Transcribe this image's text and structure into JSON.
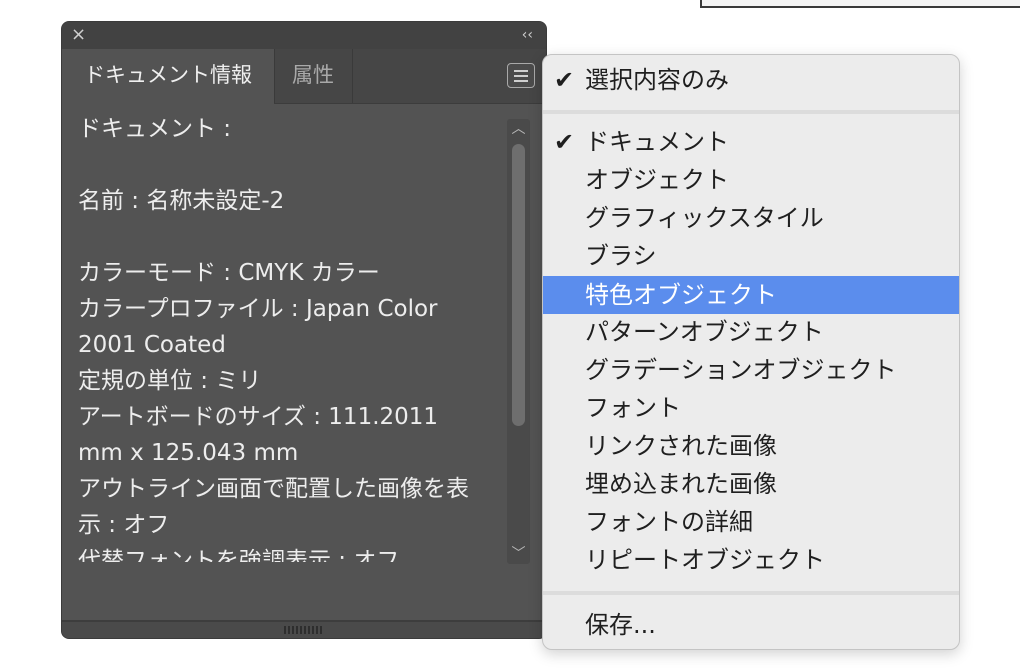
{
  "panel": {
    "close_icon": "×",
    "collapse_icon": "‹‹",
    "tabs": [
      {
        "label": "ドキュメント情報",
        "active": true
      },
      {
        "label": "属性",
        "active": false
      }
    ],
    "menu_icon": "hamburger-menu-icon",
    "content_lines": [
      "ドキュメント :",
      "",
      "名前 : 名称未設定-2",
      "",
      "カラーモード : CMYK カラー",
      "カラープロファイル : Japan Color",
      "2001 Coated",
      "定規の単位 : ミリ",
      "アートボードのサイズ : 111.2011",
      "mm x 125.043 mm",
      "アウトライン画面で配置した画像を表",
      "示 : オフ",
      "代替フォントを強調表示 : オフ"
    ]
  },
  "menu": {
    "items": [
      {
        "label": "選択内容のみ",
        "checked": true
      },
      {
        "label": "ドキュメント",
        "checked": true
      },
      {
        "label": "オブジェクト",
        "checked": false
      },
      {
        "label": "グラフィックスタイル",
        "checked": false
      },
      {
        "label": "ブラシ",
        "checked": false
      },
      {
        "label": "特色オブジェクト",
        "checked": false,
        "highlighted": true
      },
      {
        "label": "パターンオブジェクト",
        "checked": false
      },
      {
        "label": "グラデーションオブジェクト",
        "checked": false
      },
      {
        "label": "フォント",
        "checked": false
      },
      {
        "label": "リンクされた画像",
        "checked": false
      },
      {
        "label": "埋め込まれた画像",
        "checked": false
      },
      {
        "label": "フォントの詳細",
        "checked": false
      },
      {
        "label": "リピートオブジェクト",
        "checked": false
      },
      {
        "label": "保存...",
        "checked": false
      }
    ],
    "check_glyph": "✔",
    "highlight_color": "#5b8ded"
  }
}
